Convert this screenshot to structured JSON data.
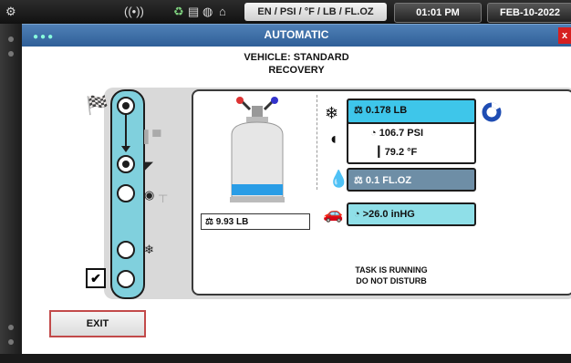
{
  "topbar": {
    "units": "EN / PSI / °F / LB / FL.OZ",
    "time": "01:01 PM",
    "date": "FEB-10-2022",
    "icons": [
      "settings-icon",
      "wifi-icon",
      "recycle-icon",
      "document-icon",
      "globe-icon",
      "car-icon"
    ]
  },
  "window": {
    "title": "AUTOMATIC",
    "close_label": "x"
  },
  "vehicle": {
    "line1": "VEHICLE: STANDARD",
    "line2": "RECOVERY"
  },
  "steps": [
    {
      "name": "step-recovery",
      "state": "active",
      "icon": "tank-icon"
    },
    {
      "name": "step-vacuum",
      "state": "active",
      "icon": "car-icon"
    },
    {
      "name": "step-oil",
      "state": "inactive",
      "icon": "oil-icon"
    },
    {
      "name": "step-charge",
      "state": "inactive",
      "icon": "snowflake-icon"
    },
    {
      "name": "step-complete",
      "state": "inactive",
      "icon": "check-icon"
    }
  ],
  "tank": {
    "weight_label": "9.93 LB",
    "fill_fraction": 0.15
  },
  "readings": {
    "refrigerant_weight": "0.178 LB",
    "pressure": "106.7 PSI",
    "temperature": "79.2 °F",
    "oil_volume": "0.1 FL.OZ",
    "vacuum": ">26.0 inHG"
  },
  "status": {
    "line1": "TASK IS RUNNING",
    "line2": "DO NOT DISTURB"
  },
  "buttons": {
    "exit": "EXIT"
  },
  "colors": {
    "accent_cyan": "#3ec6ea",
    "track_cyan": "#80d0dd",
    "title_blue": "#2f5f98",
    "exit_border": "#c24a4a"
  }
}
